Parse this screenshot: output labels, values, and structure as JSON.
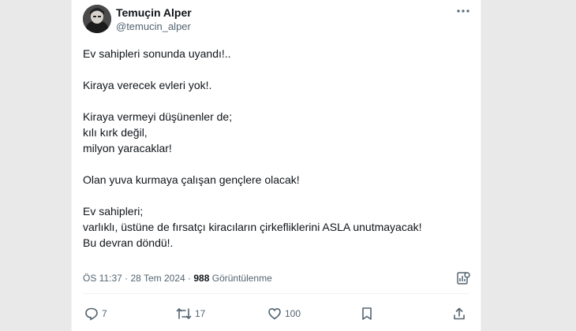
{
  "author": {
    "name": "Temuçin Alper",
    "handle": "@temucin_alper"
  },
  "tweet": {
    "paragraphs": [
      "Ev sahipleri sonunda uyandı!..",
      "Kiraya verecek evleri yok!.",
      "Kiraya vermeyi düşünenler de;\nkılı kırk değil,\nmilyon yaracaklar!",
      "Olan yuva kurmaya çalışan gençlere olacak!",
      "Ev sahipleri;\nvarlıklı, üstüne de fırsatçı kiracıların çirkefliklerini ASLA unutmayacak!\nBu devran döndü!."
    ]
  },
  "meta": {
    "time": "ÖS 11:37",
    "separator": "·",
    "date": "28 Tem 2024",
    "views_count": "988",
    "views_label": "Görüntülenme"
  },
  "actions": {
    "replies": "7",
    "reposts": "17",
    "likes": "100"
  },
  "icons": [
    "more-icon",
    "analytics-icon",
    "reply-icon",
    "repost-icon",
    "like-icon",
    "bookmark-icon",
    "share-icon"
  ],
  "colors": {
    "text": "#0f1419",
    "secondary": "#536471",
    "background": "#ffffff"
  }
}
